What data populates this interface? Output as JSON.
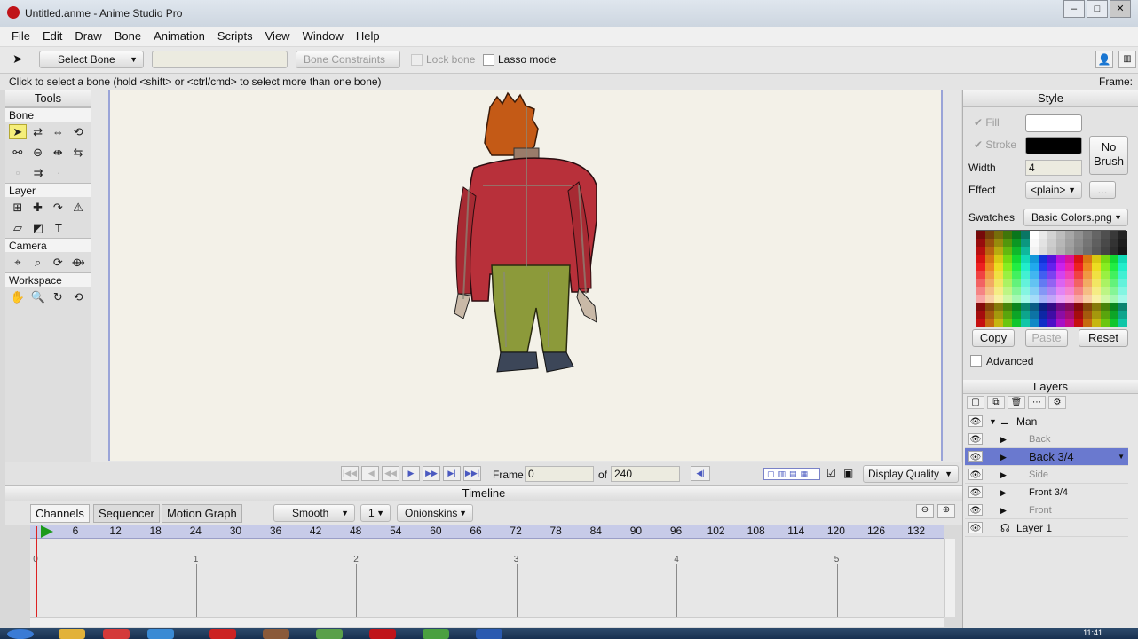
{
  "window": {
    "title": "Untitled.anme - Anime Studio Pro"
  },
  "menu": [
    "File",
    "Edit",
    "Draw",
    "Bone",
    "Animation",
    "Scripts",
    "View",
    "Window",
    "Help"
  ],
  "toolbar": {
    "select_bone": "Select Bone",
    "bone_constraints": "Bone Constraints",
    "lock_bone": "Lock bone",
    "lasso_mode": "Lasso mode"
  },
  "status": {
    "message": "Click to select a bone (hold <shift> or <ctrl/cmd> to select more than one bone)",
    "frame_label": "Frame:"
  },
  "tools": {
    "title": "Tools",
    "groups": [
      "Bone",
      "Layer",
      "Camera",
      "Workspace"
    ]
  },
  "playback": {
    "frame_label": "Frame",
    "frame_value": "0",
    "of_label": "of",
    "total_frames": "240",
    "display_quality": "Display Quality"
  },
  "timeline": {
    "title": "Timeline",
    "tabs": [
      "Channels",
      "Sequencer",
      "Motion Graph"
    ],
    "interpolation": "Smooth",
    "step": "1",
    "onionskins": "Onionskins",
    "ruler_ticks": [
      "6",
      "12",
      "18",
      "24",
      "30",
      "36",
      "42",
      "48",
      "54",
      "60",
      "66",
      "72",
      "78",
      "84",
      "90",
      "96",
      "102",
      "108",
      "114",
      "120",
      "126",
      "132"
    ],
    "seconds": [
      "0",
      "1",
      "2",
      "3",
      "4",
      "5"
    ]
  },
  "style": {
    "title": "Style",
    "fill_label": "Fill",
    "stroke_label": "Stroke",
    "width_label": "Width",
    "width_value": "4",
    "effect_label": "Effect",
    "effect_value": "<plain>",
    "effect_more": "...",
    "no_brush_line1": "No",
    "no_brush_line2": "Brush",
    "swatches_label": "Swatches",
    "swatches_value": "Basic Colors.png",
    "copy": "Copy",
    "paste": "Paste",
    "reset": "Reset",
    "advanced": "Advanced",
    "fill_color": "#ffffff",
    "stroke_color": "#000000"
  },
  "layers": {
    "title": "Layers",
    "items": [
      {
        "name": "Man"
      },
      {
        "name": "Back"
      },
      {
        "name": "Back 3/4"
      },
      {
        "name": "Side"
      },
      {
        "name": "Front 3/4"
      },
      {
        "name": "Front"
      },
      {
        "name": "Layer 1"
      }
    ]
  },
  "taskbar": {
    "clock": "11:41"
  }
}
